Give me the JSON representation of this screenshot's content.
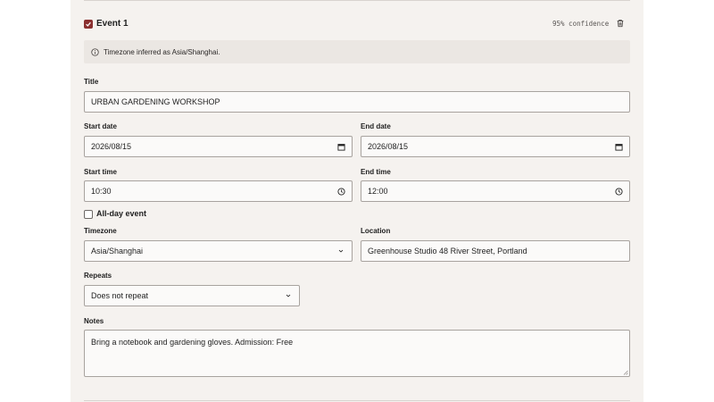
{
  "event": {
    "checked": true,
    "title": "Event 1",
    "confidence": "95% confidence"
  },
  "notice": {
    "icon": "info-icon",
    "text": "Timezone inferred as Asia/Shanghai."
  },
  "form": {
    "title": {
      "label": "Title",
      "value": "URBAN GARDENING WORKSHOP"
    },
    "start_date": {
      "label": "Start date",
      "value": "2026/08/15",
      "icon": "calendar-icon"
    },
    "end_date": {
      "label": "End date",
      "value": "2026/08/15",
      "icon": "calendar-icon"
    },
    "start_time": {
      "label": "Start time",
      "value": "10:30",
      "icon": "clock-icon"
    },
    "end_time": {
      "label": "End time",
      "value": "12:00",
      "icon": "clock-icon"
    },
    "all_day": {
      "label": "All-day event",
      "checked": false
    },
    "timezone": {
      "label": "Timezone",
      "value": "Asia/Shanghai",
      "icon": "chevron-down-icon"
    },
    "location": {
      "label": "Location",
      "value": "Greenhouse Studio 48 River Street, Portland"
    },
    "repeats": {
      "label": "Repeats",
      "value": "Does not repeat",
      "icon": "chevron-down-icon"
    },
    "notes": {
      "label": "Notes",
      "value": "Bring a notebook and gardening gloves. Admission: Free"
    }
  },
  "colors": {
    "accent": "#8a2f2f",
    "panel_bg": "#f5f2ef",
    "notice_bg": "#ebe7e3",
    "field_border": "#a8a39f"
  }
}
